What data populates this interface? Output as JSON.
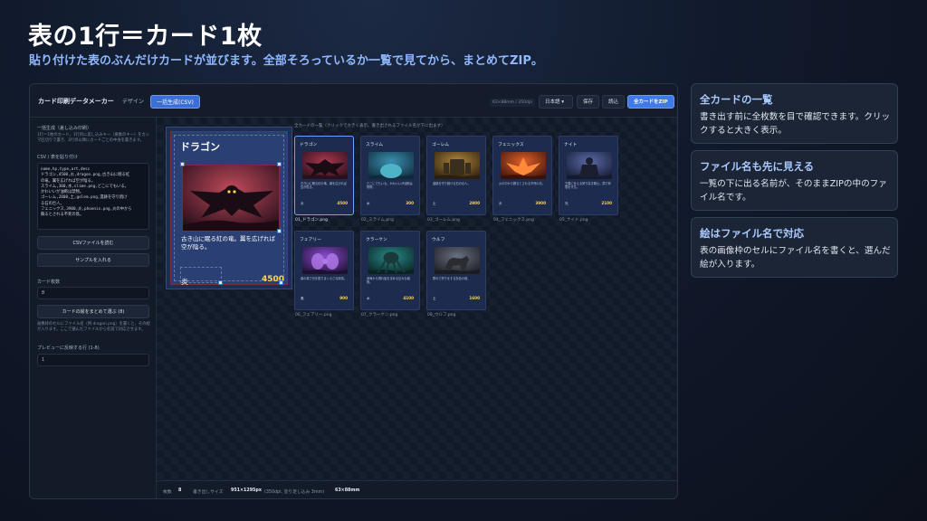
{
  "hero": {
    "title": "表の1行＝カード1枚",
    "subtitle": "貼り付けた表のぶんだけカードが並びます。全部そろっているか一覧で見てから、まとめてZIP。"
  },
  "app": {
    "title": "カード印刷データメーカー",
    "tabs": [
      {
        "label": "デザイン",
        "active": false
      },
      {
        "label": "一括生成(CSV)",
        "active": true
      }
    ],
    "size_chip": "63×88mm / 350dpi",
    "language": "日本語 ▾",
    "save_label": "保存",
    "load_label": "読込",
    "zip_label": "全カードをZIP"
  },
  "sidebar": {
    "section_label": "一括生成（差し込み印刷）",
    "section_help": "1行＝1枚のカード。1行目に差し込みキー（要素のキー）をカンマ区切りで書き、2行目以降にカードごとの中身を書きます。",
    "csv_label": "CSV / 表を貼り付け",
    "csv_lines": [
      "name,hp,type,art,desc",
      "ドラゴン,4500,炎,dragon.png,古き山に眠る紅",
      "の竜。翼を広げれば空が陰る。",
      "スライム,300,水,slime.png,どこにでもいる。",
      "かわいいが油断は禁物。",
      "ゴーレム,2800,土,golem.png,遺跡を守り続け",
      "る石の巨人。",
      "フェニックス,3900,炎,phoenix.png,炎の中から",
      "蘇るとされる不死の鳥。"
    ],
    "read_csv_label": "CSVファイルを読む",
    "sample_label": "サンプルを入れる",
    "count_label": "カード枚数",
    "count_value": "8",
    "pick_images_label": "カードの絵をまとめて選ぶ (8)",
    "images_help": "画像枠のセルにファイル名（例 dragon.png）を書くと、その絵が入ります。ここで選んだファイルから名前で対応させます。",
    "preview_row_label": "プレビューに反映する行 (1-8)",
    "preview_row_value": "1"
  },
  "main": {
    "list_hint": "全カードの一覧（クリックで大きく表示。書き出されるファイル名が下に出ます）",
    "preview": {
      "name": "ドラゴン",
      "desc": "古き山に眠る紅の竜。翼を広げれば空が陰る。",
      "type": "炎",
      "hp": "4500"
    },
    "cards": [
      {
        "name": "ドラゴン",
        "desc": "古き山に眠る紅の竜。翼を広げれば空が陰る。",
        "type": "炎",
        "hp": "4500",
        "file": "01_ドラゴン.png",
        "selected": true
      },
      {
        "name": "スライム",
        "desc": "どこにでもいる。かわいいが油断は禁物。",
        "type": "水",
        "hp": "300",
        "file": "02_スライム.png",
        "selected": false
      },
      {
        "name": "ゴーレム",
        "desc": "遺跡を守り続ける石の巨人。",
        "type": "土",
        "hp": "2800",
        "file": "03_ゴーレム.png",
        "selected": false
      },
      {
        "name": "フェニックス",
        "desc": "炎の中から蘇るとされる不死の鳥。",
        "type": "炎",
        "hp": "3900",
        "file": "04_フェニックス.png",
        "selected": false
      },
      {
        "name": "ナイト",
        "desc": "王国に仕える誇り高き騎士。盾で仲間を守る。",
        "type": "光",
        "hp": "2100",
        "file": "05_ナイト.png",
        "selected": false
      },
      {
        "name": "フェアリー",
        "desc": "森の奥で光を振りまく小さな妖精。",
        "type": "風",
        "hp": "900",
        "file": "06_フェアリー.png",
        "selected": false
      },
      {
        "name": "クラーケン",
        "desc": "深海から現れ船を沈める巨大な魔物。",
        "type": "水",
        "hp": "4100",
        "file": "07_クラーケン.png",
        "selected": false
      },
      {
        "name": "ウルフ",
        "desc": "群れで狩りをする灰色の狼。",
        "type": "土",
        "hp": "1600",
        "file": "08_ウルフ.png",
        "selected": false
      }
    ]
  },
  "status": {
    "count_label": "枚数",
    "count_value": "8",
    "size_label": "書き出しサイズ",
    "size_value": "951×1295px",
    "size_note": "(350dpi, 塗り足し込み 3mm)",
    "mm_value": "63×88mm"
  },
  "info": [
    {
      "title": "全カードの一覧",
      "body": "書き出す前に全枚数を目で確認できます。クリックすると大きく表示。"
    },
    {
      "title": "ファイル名も先に見える",
      "body": "一覧の下に出る名前が、そのままZIPの中のファイル名です。"
    },
    {
      "title": "絵はファイル名で対応",
      "body": "表の画像枠のセルにファイル名を書くと、選んだ絵が入ります。"
    }
  ],
  "colors": {
    "accent": "#3f7ae6",
    "hp": "#ffd54a",
    "card_bg": "#1d2b4e",
    "info_title": "#a9c9ff"
  }
}
